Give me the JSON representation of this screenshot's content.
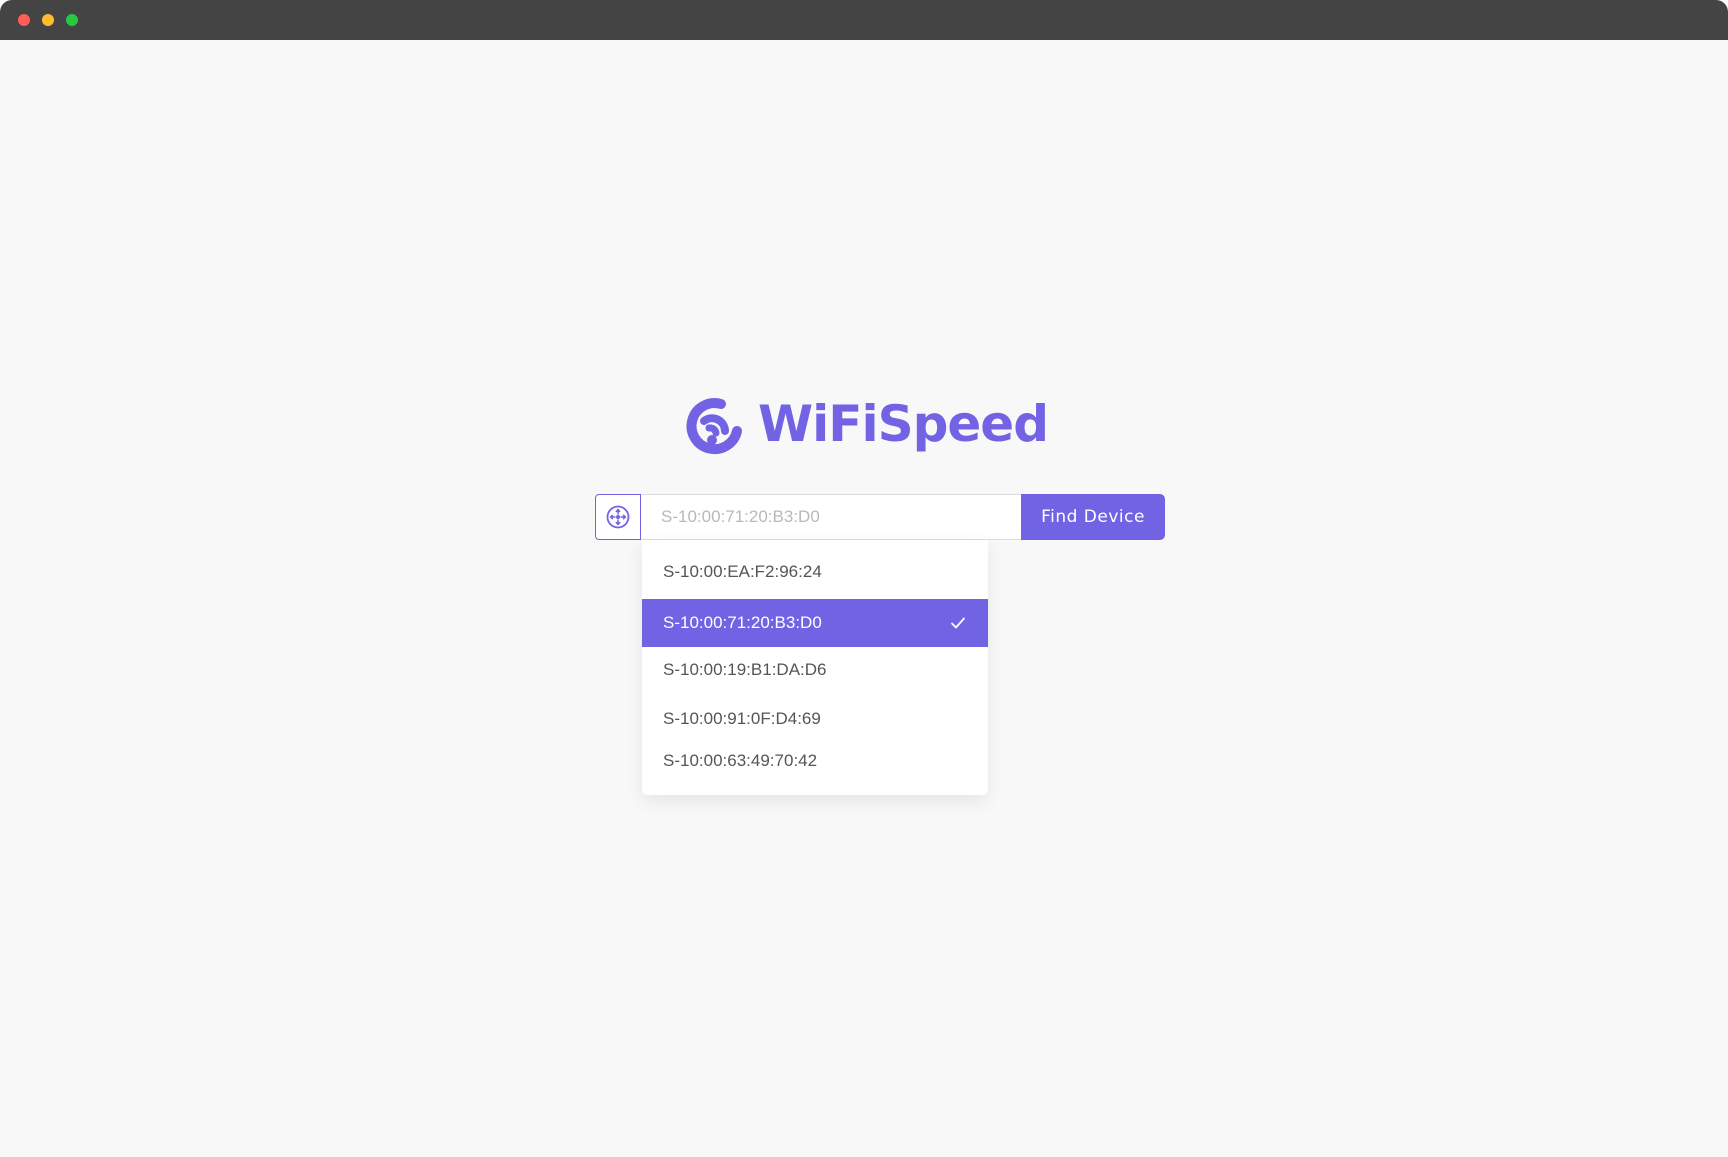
{
  "colors": {
    "accent": "#7163e3",
    "window_bg": "#f8f8f8",
    "titlebar": "#444444",
    "traffic_close": "#ff5f57",
    "traffic_minimize": "#febc2e",
    "traffic_zoom": "#28c840"
  },
  "icons": {
    "logo": "wifi-speed-logo-icon",
    "device": "network-device-icon",
    "selected": "checkmark-icon"
  },
  "app": {
    "logo_text": "WiFiSpeed"
  },
  "search": {
    "placeholder": "S-10:00:71:20:B3:D0",
    "value": "",
    "button_label": "Find Device"
  },
  "dropdown": {
    "options": [
      {
        "label": "S-10:00:EA:F2:96:24",
        "selected": false
      },
      {
        "label": "S-10:00:71:20:B3:D0",
        "selected": true
      },
      {
        "label": "S-10:00:19:B1:DA:D6",
        "selected": false
      },
      {
        "label": "S-10:00:91:0F:D4:69",
        "selected": false
      },
      {
        "label": "S-10:00:63:49:70:42",
        "selected": false
      }
    ]
  }
}
